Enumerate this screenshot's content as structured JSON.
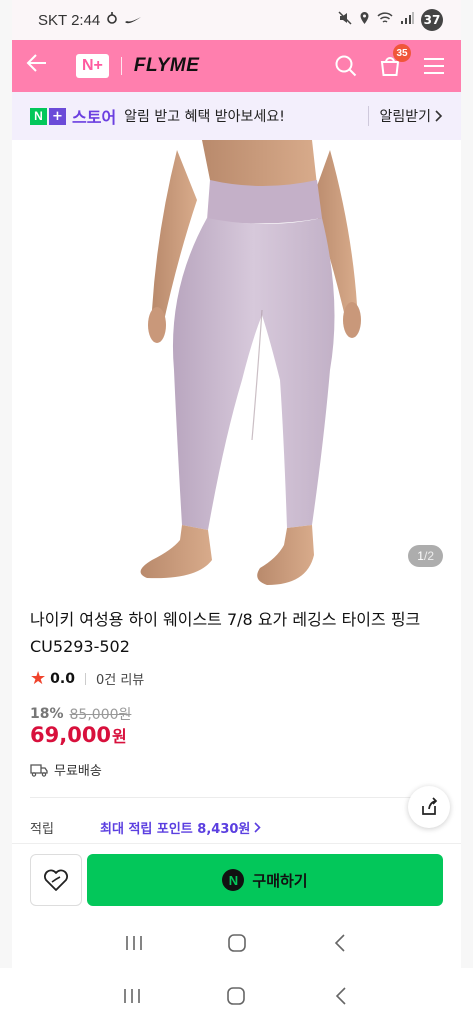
{
  "status_bar": {
    "carrier_time": "SKT 2:44",
    "battery": "37"
  },
  "header": {
    "logo_text": "N+",
    "brand": "FLYME",
    "cart_count": "35",
    "accent": "#ff7fae"
  },
  "notice": {
    "store_label": "스토어",
    "message": "알림 받고 혜택 받아보세요!",
    "action": "알림받기"
  },
  "gallery": {
    "current": "1",
    "separator": "/",
    "total": "2"
  },
  "product": {
    "title": "나이키 여성용 하이 웨이스트 7/8 요가 레깅스 타이즈 핑크 CU5293-502",
    "rating": "0.0",
    "review_count": "0건 리뷰",
    "discount": "18%",
    "original_price": "85,000원",
    "price": "69,000",
    "price_unit": "원",
    "shipping": "무료배송",
    "points_label": "적립",
    "points_value": "최대 적립 포인트 8,430원"
  },
  "actions": {
    "buy_label": "구매하기",
    "pay_icon_letter": "N",
    "buy_color": "#03c75a"
  }
}
